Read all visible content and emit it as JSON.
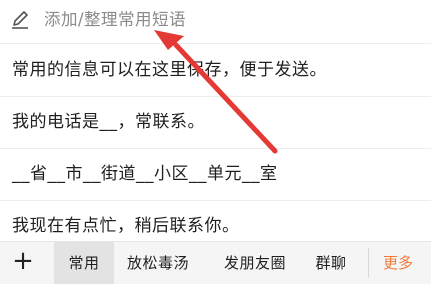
{
  "header": {
    "icon": "edit-pencil-icon",
    "placeholder": "添加/整理常用短语"
  },
  "phrases": [
    "常用的信息可以在这里保存，便于发送。",
    "我的电话是__，常联系。",
    "__省__市__街道__小区__单元__室",
    "我现在有点忙，稍后联系你。"
  ],
  "tabbar": {
    "add_icon": "plus-icon",
    "add_label": "+",
    "tabs": [
      "常用",
      "放松毒汤",
      "发朋友圈",
      "群聊"
    ],
    "selected_tab": "常用",
    "more_label": "更多",
    "more_color": "#f07a3a"
  },
  "annotation": {
    "arrow_color": "#e53935"
  }
}
